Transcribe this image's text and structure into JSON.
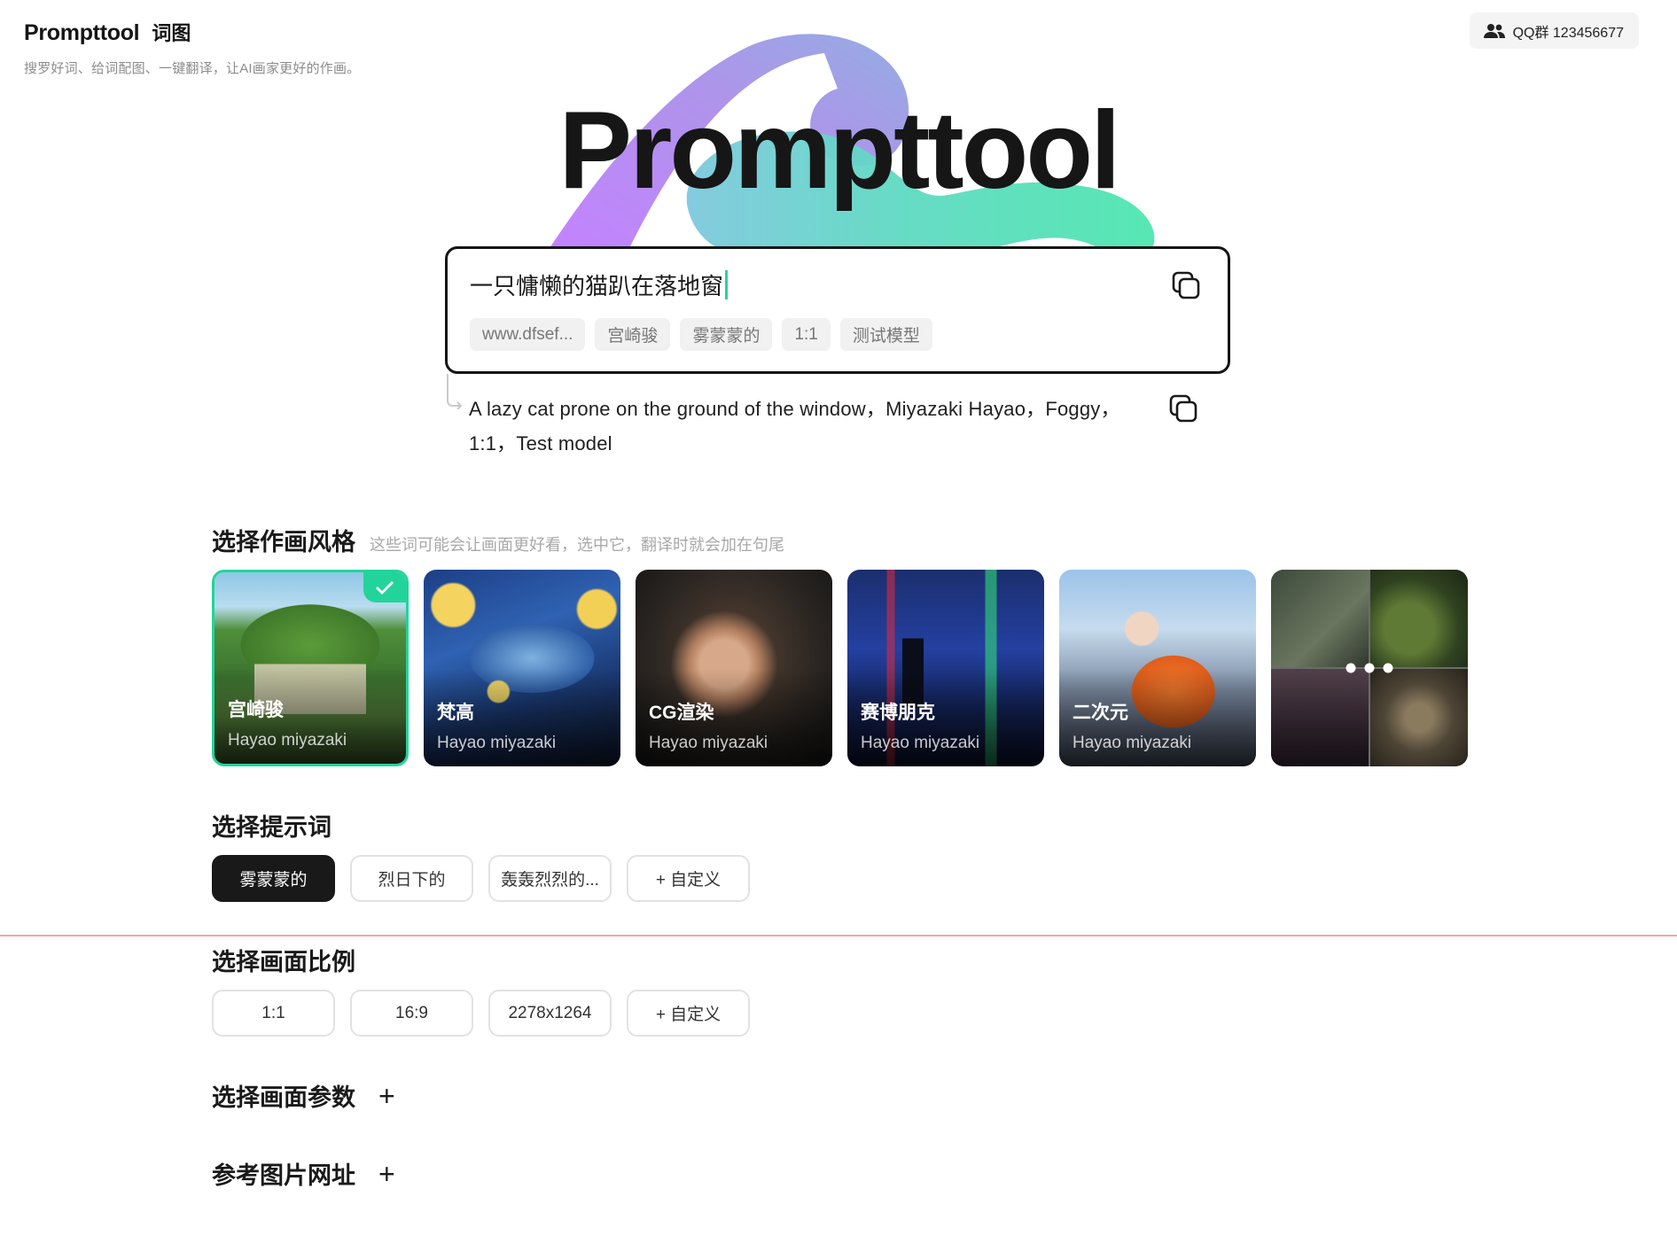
{
  "header": {
    "brand": "Prompttool",
    "brand_cn": "词图",
    "subtitle": "搜罗好词、给词配图、一键翻译，让AI画家更好的作画。",
    "qq_label": "QQ群 123456677",
    "qq_icon": "group-icon"
  },
  "hero": {
    "title": "Prompttool"
  },
  "prompt": {
    "text": "一只慵懒的猫趴在落地窗",
    "tags": [
      "www.dfsef...",
      "宫崎骏",
      "雾蒙蒙的",
      "1:1",
      "测试模型"
    ],
    "copy_icon": "copy-icon"
  },
  "translation": {
    "text": "A lazy cat prone on the ground of the window，Miyazaki Hayao，Foggy，1:1，Test model"
  },
  "style_section": {
    "title": "选择作画风格",
    "hint": "这些词可能会让画面更好看，选中它，翻译时就会加在句尾",
    "cards": [
      {
        "name": "宫崎骏",
        "sub": "Hayao miyazaki",
        "selected": true
      },
      {
        "name": "梵高",
        "sub": "Hayao miyazaki",
        "selected": false
      },
      {
        "name": "CG渲染",
        "sub": "Hayao miyazaki",
        "selected": false
      },
      {
        "name": "赛博朋克",
        "sub": "Hayao miyazaki",
        "selected": false
      },
      {
        "name": "二次元",
        "sub": "Hayao miyazaki",
        "selected": false
      }
    ],
    "more_icon": "more-dots-icon"
  },
  "keyword_section": {
    "title": "选择提示词",
    "options": [
      "雾蒙蒙的",
      "烈日下的",
      "轰轰烈烈的...",
      "+ 自定义"
    ],
    "active_index": 0
  },
  "ratio_section": {
    "title": "选择画面比例",
    "options": [
      "1:1",
      "16:9",
      "2278x1264",
      "+ 自定义"
    ]
  },
  "params_section": {
    "title": "选择画面参数",
    "plus": "+"
  },
  "ref_section": {
    "title": "参考图片网址",
    "plus": "+"
  },
  "colors": {
    "accent": "#23d49a",
    "text": "#1c1c1c",
    "active_pill": "#191919",
    "divider": "#f1a7a7"
  }
}
